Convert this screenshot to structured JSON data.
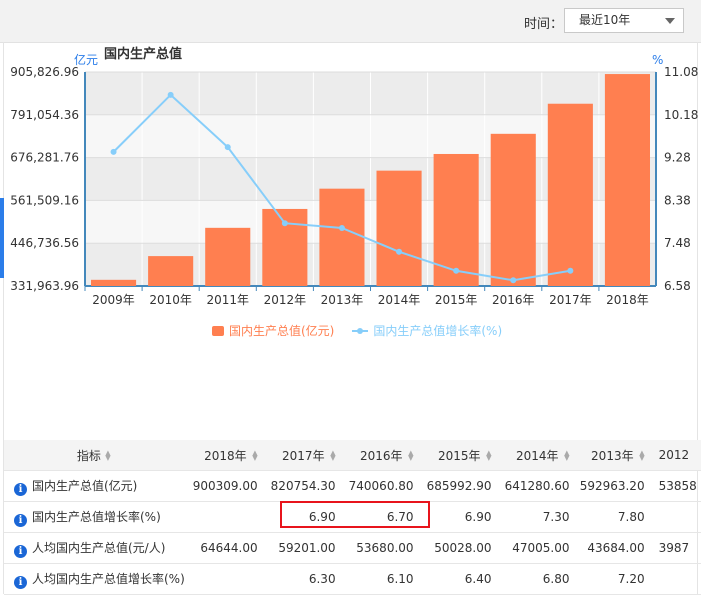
{
  "toolbar": {
    "time_label": "时间：",
    "range_value": "最近10年"
  },
  "chart_data": {
    "type": "bar",
    "title": "国内生产总值",
    "left_unit": "亿元",
    "right_unit": "%",
    "categories": [
      "2009年",
      "2010年",
      "2011年",
      "2012年",
      "2013年",
      "2014年",
      "2015年",
      "2016年",
      "2017年",
      "2018年"
    ],
    "series": [
      {
        "name": "国内生产总值(亿元)",
        "type": "bar",
        "axis": "left",
        "color": "#ff7f50",
        "values": [
          348517.7,
          412119.3,
          487940.2,
          538580.0,
          592963.2,
          641280.6,
          685992.9,
          740060.8,
          820754.3,
          900309.0
        ]
      },
      {
        "name": "国内生产总值增长率(%)",
        "type": "line",
        "axis": "right",
        "color": "#87cefa",
        "values": [
          9.4,
          10.6,
          9.5,
          7.9,
          7.8,
          7.3,
          6.9,
          6.7,
          6.9,
          null
        ]
      }
    ],
    "left_ticks": [
      "905,826.96",
      "791,054.36",
      "676,281.76",
      "561,509.16",
      "446,736.56",
      "331,963.96"
    ],
    "right_ticks": [
      "11.08",
      "10.18",
      "9.28",
      "8.38",
      "7.48",
      "6.58"
    ],
    "ylim_left": [
      331963.96,
      905826.96
    ],
    "ylim_right": [
      6.58,
      11.08
    ],
    "grid": true,
    "legend_position": "bottom"
  },
  "table": {
    "header_indicator": "指标",
    "years": [
      "2018年",
      "2017年",
      "2016年",
      "2015年",
      "2014年",
      "2013年",
      "2012"
    ],
    "rows": [
      {
        "name": "国内生产总值(亿元)",
        "values": [
          "900309.00",
          "820754.30",
          "740060.80",
          "685992.90",
          "641280.60",
          "592963.20",
          "53858"
        ]
      },
      {
        "name": "国内生产总值增长率(%)",
        "values": [
          "",
          "6.90",
          "6.70",
          "6.90",
          "7.30",
          "7.80",
          ""
        ]
      },
      {
        "name": "人均国内生产总值(元/人)",
        "values": [
          "64644.00",
          "59201.00",
          "53680.00",
          "50028.00",
          "47005.00",
          "43684.00",
          "3987"
        ]
      },
      {
        "name": "人均国内生产总值增长率(%)",
        "values": [
          "",
          "6.30",
          "6.10",
          "6.40",
          "6.80",
          "7.20",
          ""
        ]
      }
    ]
  }
}
